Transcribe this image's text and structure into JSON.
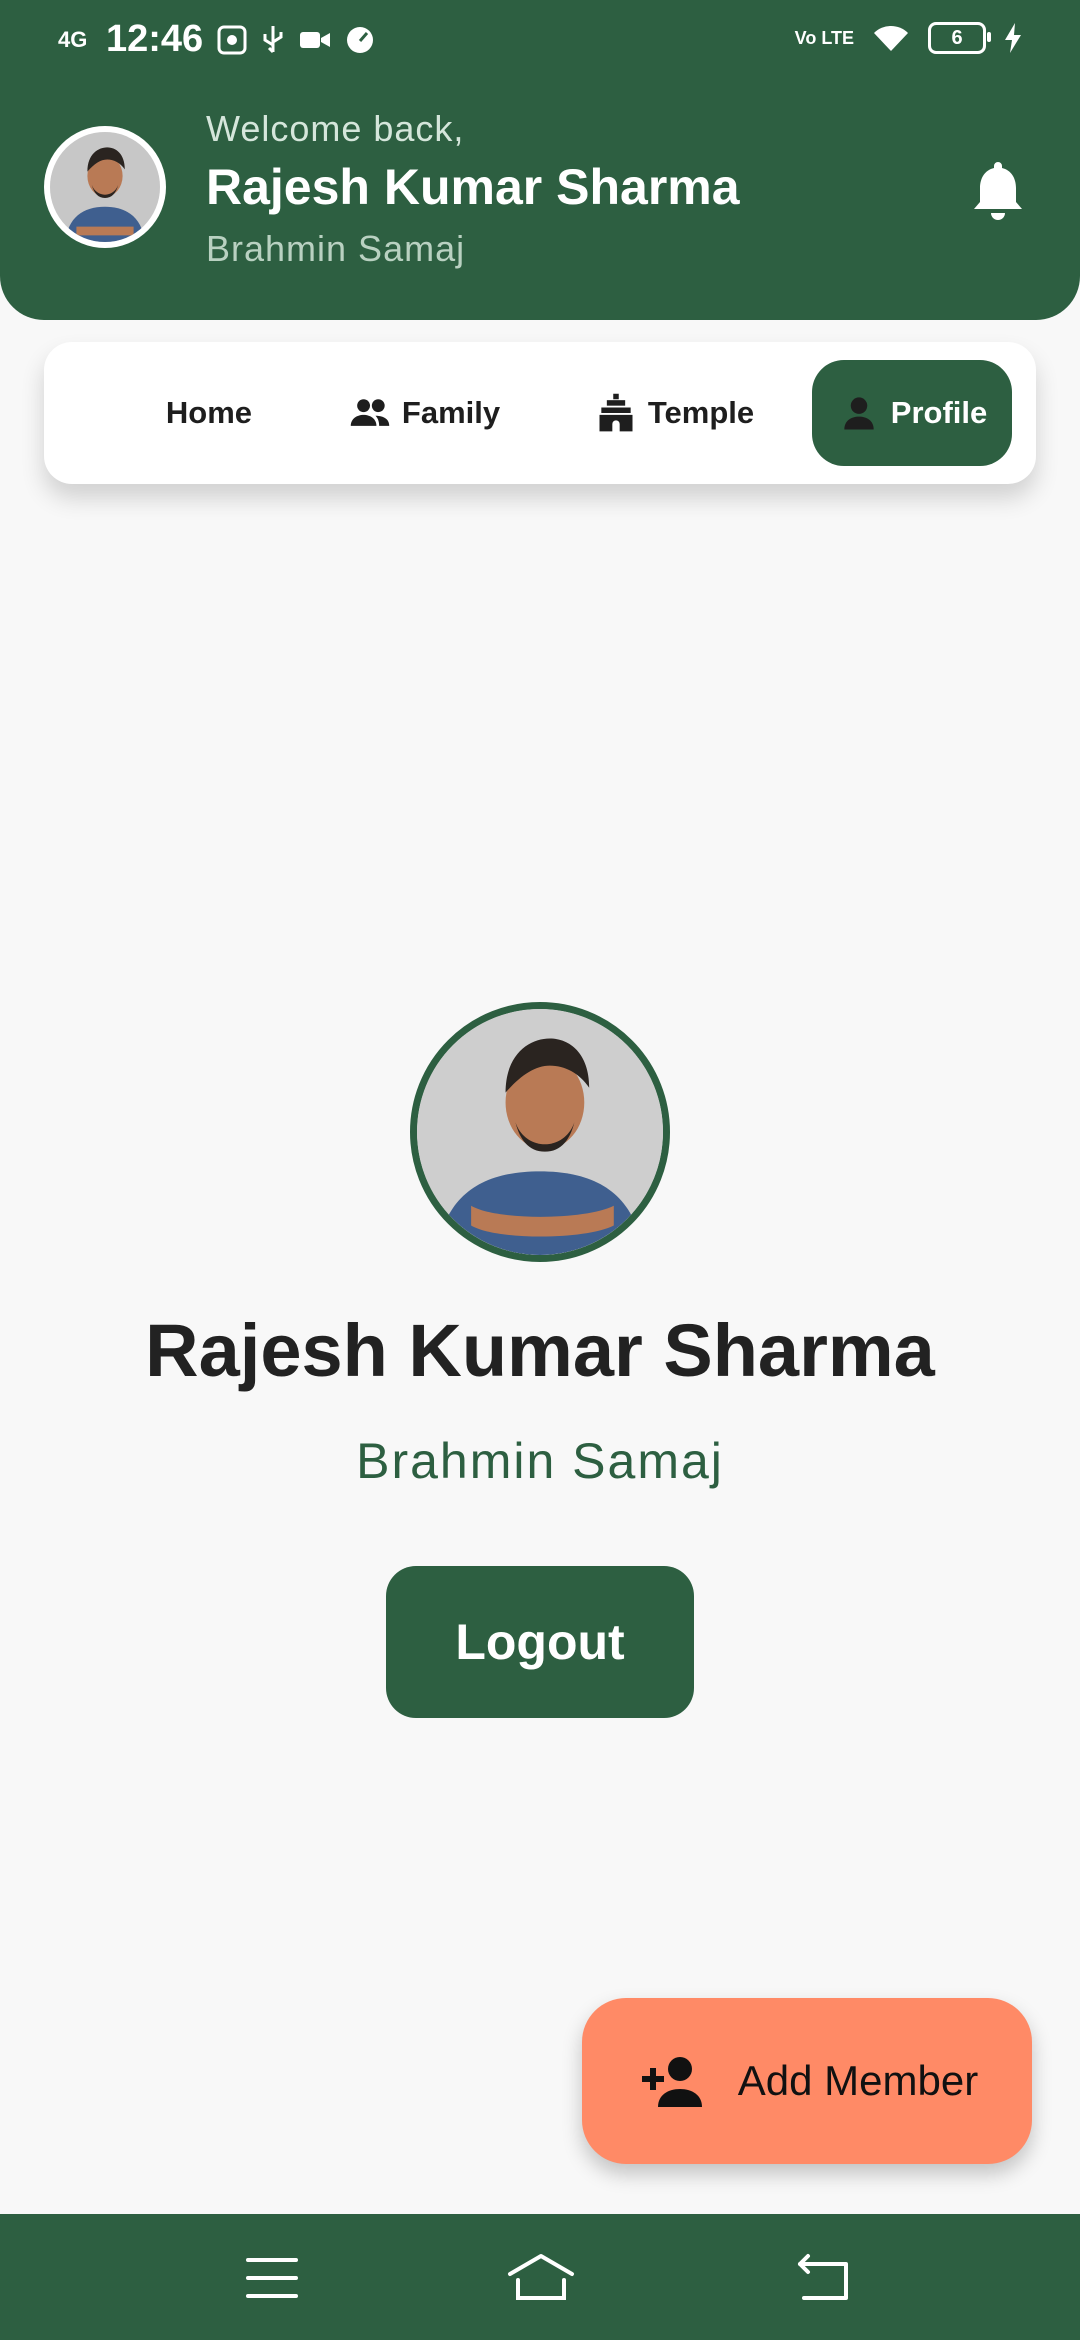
{
  "status_bar": {
    "time": "12:46",
    "network": "4G",
    "volte": "Vo LTE",
    "battery": "6"
  },
  "header": {
    "welcome": "Welcome back,",
    "name": "Rajesh Kumar Sharma",
    "samaj": "Brahmin Samaj"
  },
  "tabs": [
    {
      "label": "Home",
      "icon": "home",
      "active": false
    },
    {
      "label": "Family",
      "icon": "people-icon",
      "active": false
    },
    {
      "label": "Temple",
      "icon": "temple-icon",
      "active": false
    },
    {
      "label": "Profile",
      "icon": "person-icon",
      "active": true
    }
  ],
  "profile": {
    "name": "Rajesh Kumar Sharma",
    "samaj": "Brahmin Samaj",
    "logout_label": "Logout"
  },
  "fab": {
    "label": "Add Member",
    "icon": "add-person-icon"
  },
  "colors": {
    "primary": "#2d5f41",
    "fab": "#ff8a66",
    "background": "#f8f8f8"
  }
}
